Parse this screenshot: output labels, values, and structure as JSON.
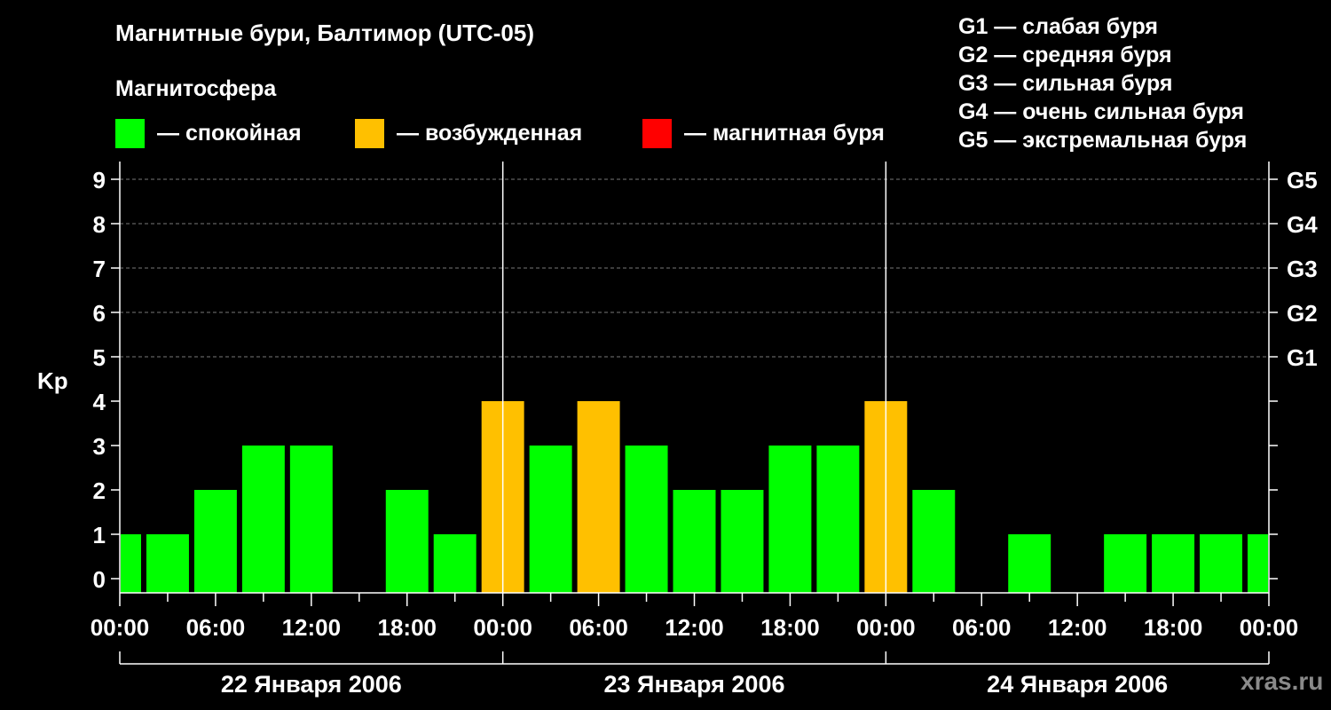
{
  "title": "Магнитные бури, Балтимор (UTC-05)",
  "subtitle": "Магнитосфера",
  "legend": [
    {
      "label": "— спокойная",
      "color": "#00ff00"
    },
    {
      "label": "— возбужденная",
      "color": "#ffc000"
    },
    {
      "label": "— магнитная буря",
      "color": "#ff0000"
    }
  ],
  "g_legend": [
    "G1 — слабая буря",
    "G2 — средняя буря",
    "G3 — сильная буря",
    "G4 — очень сильная буря",
    "G5 — экстремальная буря"
  ],
  "watermark": "xras.ru",
  "chart_data": {
    "type": "bar",
    "ylabel": "Kp",
    "ylim": [
      0,
      9
    ],
    "yticks": [
      "0",
      "1",
      "2",
      "3",
      "4",
      "5",
      "6",
      "7",
      "8",
      "9"
    ],
    "right_labels": [
      {
        "level": 5,
        "label": "G1"
      },
      {
        "level": 6,
        "label": "G2"
      },
      {
        "level": 7,
        "label": "G3"
      },
      {
        "level": 8,
        "label": "G4"
      },
      {
        "level": 9,
        "label": "G5"
      }
    ],
    "xtick_labels": [
      "00:00",
      "06:00",
      "12:00",
      "18:00",
      "00:00",
      "06:00",
      "12:00",
      "18:00",
      "00:00",
      "06:00",
      "12:00",
      "18:00",
      "00:00"
    ],
    "days": [
      "22 Января 2006",
      "23 Января 2006",
      "24 Января 2006"
    ],
    "interval_hours": 3,
    "values": [
      1,
      1,
      2,
      3,
      3,
      0,
      2,
      1,
      4,
      3,
      4,
      3,
      2,
      2,
      3,
      3,
      4,
      2,
      0,
      1,
      0,
      1,
      1,
      1,
      1
    ],
    "colors": {
      "quiet": "#00ff00",
      "active": "#ffc000",
      "storm": "#ff0000"
    }
  }
}
